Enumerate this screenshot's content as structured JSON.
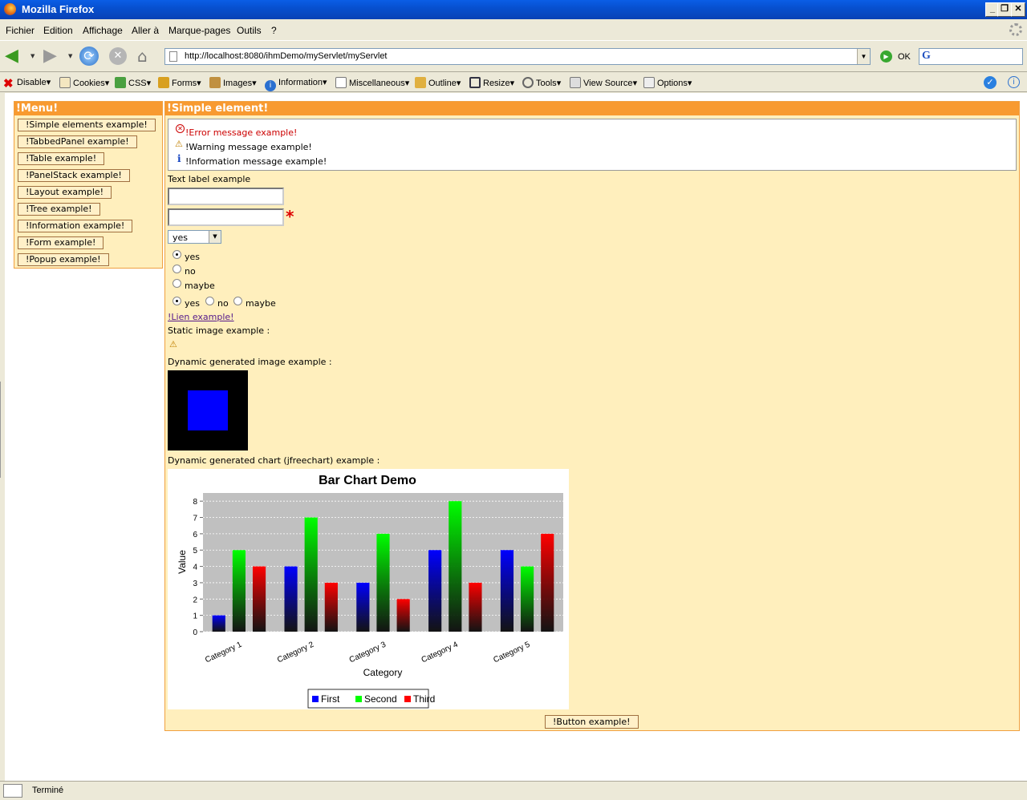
{
  "window": {
    "title": "Mozilla Firefox"
  },
  "menubar": [
    "Fichier",
    "Edition",
    "Affichage",
    "Aller à",
    "Marque-pages",
    "Outils",
    "?"
  ],
  "navbar": {
    "url": "http://localhost:8080/ihmDemo/myServlet/myServlet",
    "go_label": "OK"
  },
  "webdev_toolbar": [
    "Disable",
    "Cookies",
    "CSS",
    "Forms",
    "Images",
    "Information",
    "Miscellaneous",
    "Outline",
    "Resize",
    "Tools",
    "View Source",
    "Options"
  ],
  "menu_panel": {
    "title": "!Menu!",
    "items": [
      "!Simple elements example!",
      "!TabbedPanel example!",
      "!Table example!",
      "!PanelStack example!",
      "!Layout example!",
      "!Tree example!",
      "!Information example!",
      "!Form example!",
      "!Popup example!"
    ]
  },
  "main_panel": {
    "title": "!Simple element!",
    "messages": {
      "error": "!Error message example!",
      "warning": "!Warning message example!",
      "info": "!Information message example!"
    },
    "text_label": "Text label example",
    "input1_value": "",
    "input2_value": "",
    "select_value": "yes",
    "radio_vertical": [
      "yes",
      "no",
      "maybe"
    ],
    "radio_horizontal": [
      "yes",
      "no",
      "maybe"
    ],
    "link_text": "!Lien example!",
    "static_image_label": "Static image example :",
    "dynamic_image_label": "Dynamic generated image example :",
    "chart_label": "Dynamic generated chart (jfreechart) example :",
    "button_label": "!Button example!"
  },
  "chart_data": {
    "type": "bar",
    "title": "Bar Chart Demo",
    "xlabel": "Category",
    "ylabel": "Value",
    "categories": [
      "Category 1",
      "Category 2",
      "Category 3",
      "Category 4",
      "Category 5"
    ],
    "series": [
      {
        "name": "First",
        "values": [
          1,
          4,
          3,
          5,
          5
        ],
        "color": "#0000ff"
      },
      {
        "name": "Second",
        "values": [
          5,
          7,
          6,
          8,
          4
        ],
        "color": "#00ff00"
      },
      {
        "name": "Third",
        "values": [
          4,
          3,
          2,
          3,
          6
        ],
        "color": "#ff0000"
      }
    ],
    "ylim": [
      0,
      8.5
    ],
    "yticks": [
      0,
      1,
      2,
      3,
      4,
      5,
      6,
      7,
      8
    ],
    "grid": true,
    "legend": "bottom"
  },
  "statusbar": {
    "text": "Terminé"
  },
  "colors": {
    "panel_header": "#f89a30",
    "panel_bg": "#ffefbd",
    "error": "#cc0000"
  }
}
